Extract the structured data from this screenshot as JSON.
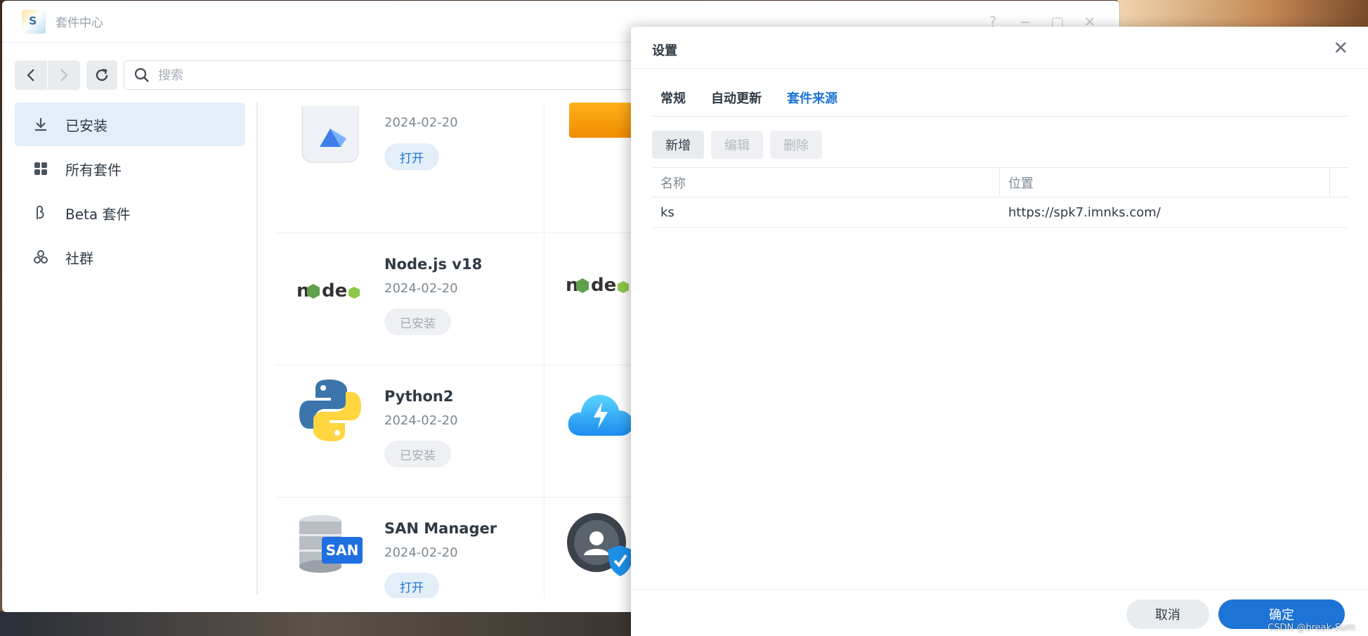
{
  "app": {
    "title": "套件中心",
    "logo_letter": "S"
  },
  "window_controls": {
    "help": "?",
    "minimize": "−",
    "maximize": "▢",
    "close": "✕"
  },
  "toolbar": {
    "search_placeholder": "搜索"
  },
  "sidebar": {
    "items": [
      {
        "label": "已安装",
        "icon": "download-icon",
        "active": true
      },
      {
        "label": "所有套件",
        "icon": "grid-icon",
        "active": false
      },
      {
        "label": "Beta 套件",
        "icon": "beta-icon",
        "active": false
      },
      {
        "label": "社群",
        "icon": "community-icon",
        "active": false
      }
    ]
  },
  "packages": [
    {
      "name": "",
      "date": "2024-02-20",
      "button": "打开",
      "installed": false,
      "icon": "synology-drive-icon"
    },
    {
      "name": "Node.js v18",
      "date": "2024-02-20",
      "button": "已安装",
      "installed": true,
      "icon": "nodejs-icon"
    },
    {
      "name": "Python2",
      "date": "2024-02-20",
      "button": "已安装",
      "installed": true,
      "icon": "python-icon"
    },
    {
      "name": "SAN Manager",
      "date": "2024-02-20",
      "button": "打开",
      "installed": false,
      "icon": "san-manager-icon",
      "icon_text": "SAN"
    }
  ],
  "dialog": {
    "title": "设置",
    "close": "✕",
    "tabs": [
      {
        "label": "常规",
        "active": false
      },
      {
        "label": "自动更新",
        "active": false
      },
      {
        "label": "套件来源",
        "active": true
      }
    ],
    "actions": {
      "add": "新增",
      "edit": "编辑",
      "delete": "删除"
    },
    "table": {
      "headers": {
        "name": "名称",
        "location": "位置"
      },
      "rows": [
        {
          "name": "ks",
          "location": "https://spk7.imnks.com/"
        }
      ]
    },
    "footer": {
      "cancel": "取消",
      "ok": "确定"
    }
  },
  "watermark": "CSDN @break-Sum",
  "colors": {
    "accent": "#1e74d6",
    "sidebar_active_bg": "#e3eef9",
    "text": "#2f3a45"
  }
}
